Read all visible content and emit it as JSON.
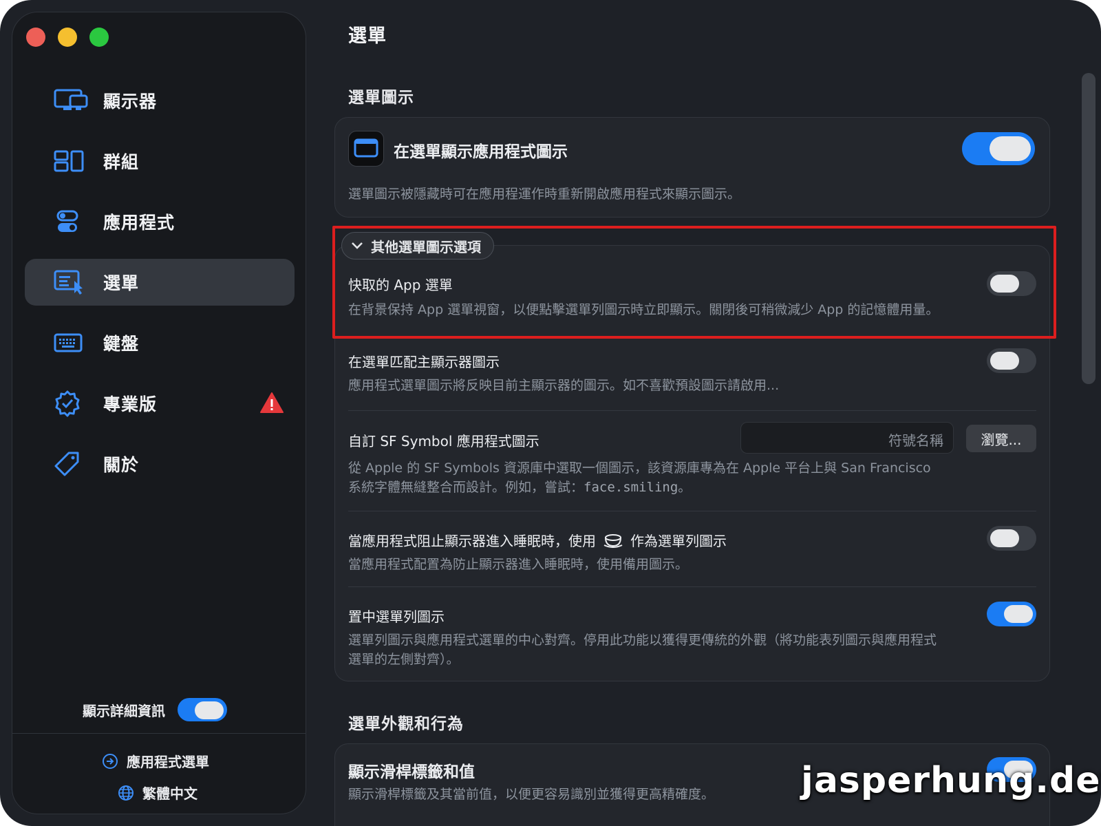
{
  "sidebar": {
    "items": [
      {
        "label": "顯示器",
        "icon": "display-icon"
      },
      {
        "label": "群組",
        "icon": "group-icon"
      },
      {
        "label": "應用程式",
        "icon": "toggles-icon"
      },
      {
        "label": "選單",
        "icon": "menu-icon",
        "active": true
      },
      {
        "label": "鍵盤",
        "icon": "keyboard-icon"
      },
      {
        "label": "專業版",
        "icon": "verified-badge-icon",
        "warning": true
      },
      {
        "label": "關於",
        "icon": "tag-icon"
      }
    ],
    "show_details_label": "顯示詳細資訊",
    "show_details_on": true,
    "footer_app_menu": "應用程式選單",
    "footer_language": "繁體中文"
  },
  "main": {
    "page_title": "選單",
    "section_icon": {
      "title": "選單圖示",
      "show_app_icon": {
        "title": "在選單顯示應用程式圖示",
        "desc": "選單圖示被隱藏時可在應用程運作時重新開啟應用程式來顯示圖示。",
        "on": true
      },
      "more_options_label": "其他選單圖示選項",
      "cache_app_menu": {
        "title": "快取的 App 選單",
        "desc": "在背景保持 App 選單視窗，以便點擊選單列圖示時立即顯示。關閉後可稍微減少 App 的記憶體用量。",
        "on": false
      },
      "match_main_display": {
        "title": "在選單匹配主顯示器圖示",
        "desc": "應用程式選單圖示將反映目前主顯示器的圖示。如不喜歡預設圖示請啟用...",
        "on": false
      },
      "custom_sf_symbol": {
        "title": "自訂 SF Symbol 應用程式圖示",
        "placeholder": "符號名稱",
        "browse_label": "瀏覽...",
        "desc_line1": "從 Apple 的 SF Symbols 資源庫中選取一個圖示，該資源庫專為在 Apple 平台上與 San Francisco",
        "desc_line2_pre": "系統字體無縫整合而設計。例如，嘗試：",
        "desc_line2_code": "face.smiling",
        "desc_line2_post": "。"
      },
      "sleep_prevent_icon": {
        "title_pre": "當應用程式阻止顯示器進入睡眠時，使用",
        "title_post": "作為選單列圖示",
        "icon": "coffee-cup-icon",
        "desc": "當應用程式配置為防止顯示器進入睡眠時，使用備用圖示。",
        "on": false
      },
      "center_menubar_icon": {
        "title": "置中選單列圖示",
        "desc_line1": "選單列圖示與應用程式選單的中心對齊。停用此功能以獲得更傳統的外觀（將功能表列圖示與應用程式",
        "desc_line2": "選單的左側對齊）。",
        "on": true
      }
    },
    "section_appearance": {
      "title": "選單外觀和行為",
      "show_slider_labels": {
        "title": "顯示滑桿標籤和值",
        "desc": "顯示滑桿標籤及其當前值，以便更容易識別並獲得更高精確度。",
        "on": true
      }
    }
  },
  "watermark": "jasperhung.dev",
  "colors": {
    "accent": "#1b7cf3",
    "warning": "#e5383b",
    "highlight": "#dc1e1e"
  }
}
